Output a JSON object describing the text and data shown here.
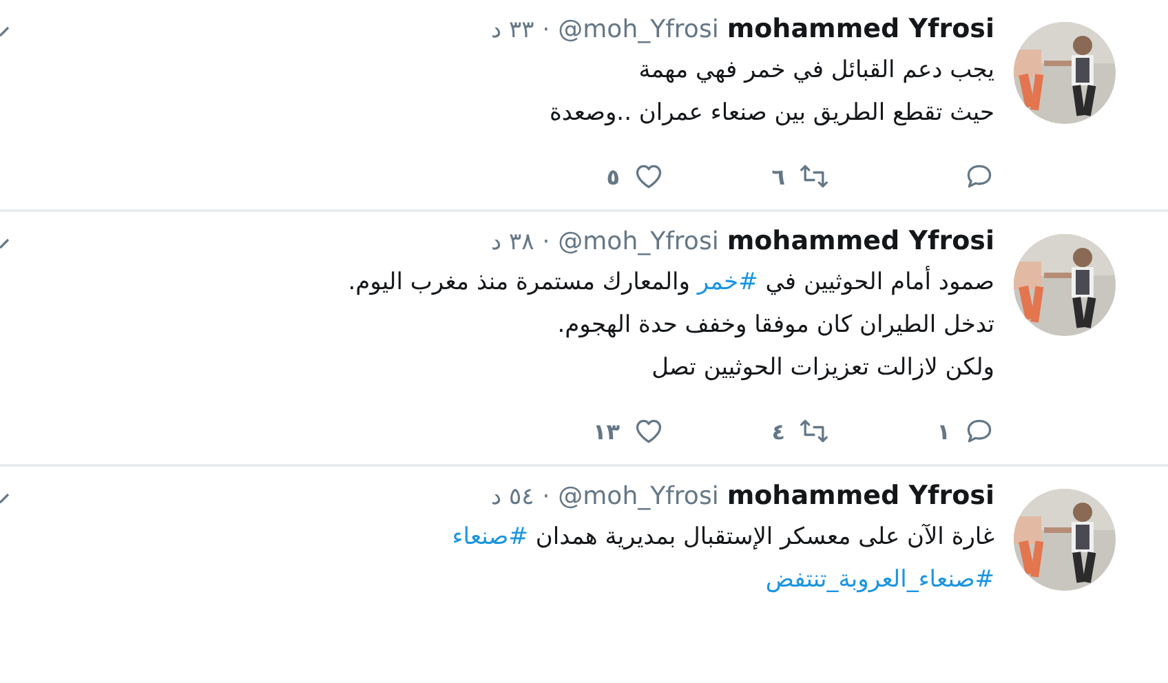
{
  "tweets": [
    {
      "name": "mohammed Yfrosi",
      "handle": "@moh_Yfrosi",
      "separator": "·",
      "time": "٣٣ د",
      "lines": [
        [
          {
            "kind": "text",
            "text": "يجب دعم القبائل في خمر فهي مهمة"
          }
        ],
        [
          {
            "kind": "text",
            "text": "حيث تقطع الطريق بين صنعاء عمران ..وصعدة"
          }
        ]
      ],
      "actions": [
        {
          "kind": "reply"
        },
        {
          "kind": "retweet",
          "count": "٦"
        },
        {
          "kind": "like",
          "count": "٥"
        }
      ]
    },
    {
      "name": "mohammed Yfrosi",
      "handle": "@moh_Yfrosi",
      "separator": "·",
      "time": "٣٨ د",
      "lines": [
        [
          {
            "kind": "text",
            "text": "صمود أمام الحوثيين في "
          },
          {
            "kind": "hashtag",
            "text": "#خمر"
          },
          {
            "kind": "text",
            "text": " والمعارك مستمرة منذ مغرب اليوم."
          }
        ],
        [
          {
            "kind": "text",
            "text": "تدخل الطيران كان موفقا وخفف حدة الهجوم."
          }
        ],
        [
          {
            "kind": "text",
            "text": "ولكن لازالت تعزيزات الحوثيين تصل"
          }
        ]
      ],
      "actions": [
        {
          "kind": "reply",
          "count": "١"
        },
        {
          "kind": "retweet",
          "count": "٤"
        },
        {
          "kind": "like",
          "count": "١٣"
        }
      ]
    },
    {
      "name": "mohammed Yfrosi",
      "handle": "@moh_Yfrosi",
      "separator": "·",
      "time": "٥٤ د",
      "lines": [
        [
          {
            "kind": "text",
            "text": "غارة الآن على معسكر الإستقبال بمديرية همدان "
          },
          {
            "kind": "hashtag",
            "text": "#صنعاء"
          }
        ],
        [
          {
            "kind": "hashtag",
            "text": "#صنعاء_العروبة_تنتفض"
          }
        ]
      ]
    }
  ]
}
